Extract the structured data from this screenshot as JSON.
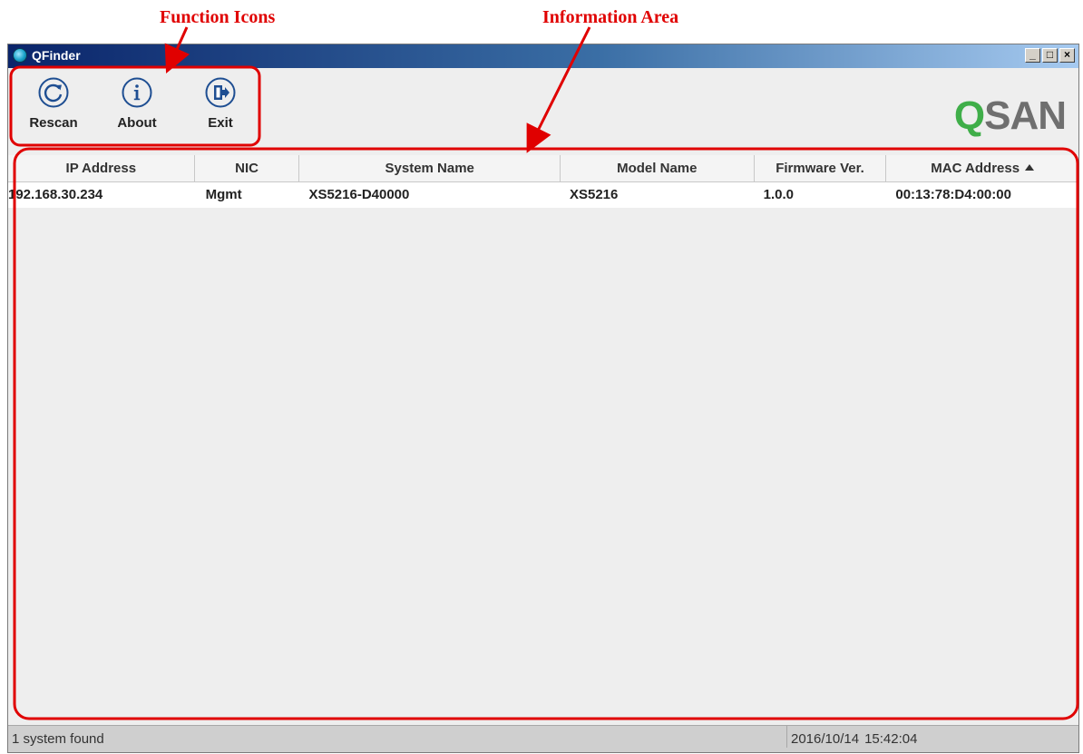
{
  "annotations": {
    "function_icons_label": "Function Icons",
    "information_area_label": "Information Area",
    "color": "#e00000"
  },
  "window": {
    "title": "QFinder",
    "controls": {
      "minimize": "_",
      "maximize": "□",
      "close": "×"
    }
  },
  "toolbar": {
    "items": [
      {
        "label": "Rescan",
        "icon": "rescan-icon"
      },
      {
        "label": "About",
        "icon": "info-icon"
      },
      {
        "label": "Exit",
        "icon": "exit-icon"
      }
    ],
    "logo": {
      "q": "Q",
      "rest": "SAN",
      "color_q": "#3fae49",
      "color_text": "#6f6f6f"
    }
  },
  "table": {
    "columns": [
      "IP Address",
      "NIC",
      "System Name",
      "Model Name",
      "Firmware Ver.",
      "MAC Address"
    ],
    "sorted_column": "MAC Address",
    "sort_direction": "ascending",
    "rows": [
      [
        "192.168.30.234",
        "Mgmt",
        "XS5216-D40000",
        "XS5216",
        "1.0.0",
        "00:13:78:D4:00:00"
      ]
    ]
  },
  "status": {
    "message": "1 system found",
    "date": "2016/10/14",
    "time": "15:42:04"
  }
}
